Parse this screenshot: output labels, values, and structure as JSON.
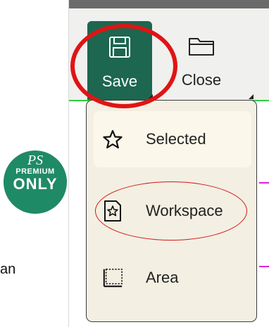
{
  "background": {
    "text_fragment": "an"
  },
  "badge": {
    "line1": "PS",
    "line2": "PREMIUM",
    "line3": "ONLY",
    "color": "#1f8a66"
  },
  "toolbar": {
    "save": {
      "label": "Save",
      "icon": "floppy-disk-icon",
      "color": "#1d6650"
    },
    "close": {
      "label": "Close",
      "icon": "folder-icon"
    }
  },
  "menu": {
    "items": [
      {
        "label": "Selected",
        "icon": "star-icon"
      },
      {
        "label": "Workspace",
        "icon": "document-star-icon"
      },
      {
        "label": "Area",
        "icon": "area-selection-icon"
      }
    ]
  },
  "annotation_color": "#e01414"
}
